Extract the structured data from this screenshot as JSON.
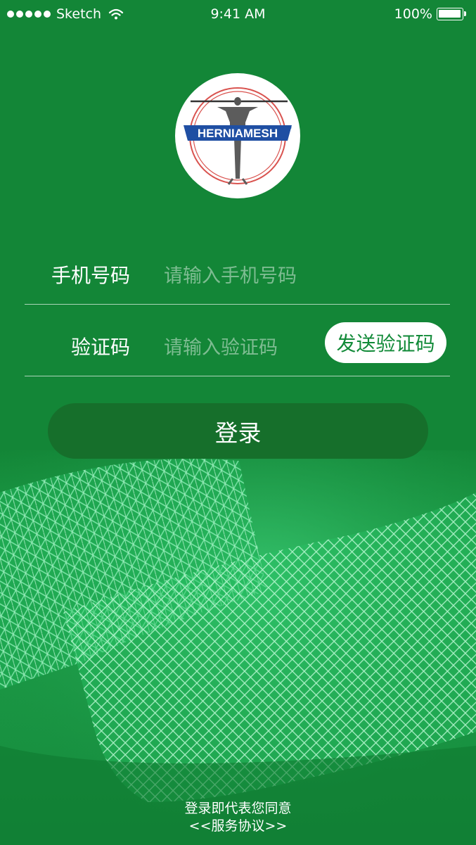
{
  "status_bar": {
    "carrier": "Sketch",
    "time": "9:41 AM",
    "battery": "100%",
    "battery_level": 1.0
  },
  "logo": {
    "brand_text": "HERNIAMESH",
    "registered_mark": "®"
  },
  "form": {
    "phone_label": "手机号码",
    "phone_placeholder": "请输入手机号码",
    "phone_value": "",
    "code_label": "验证码",
    "code_placeholder": "请输入验证码",
    "code_value": "",
    "send_code_label": "发送验证码",
    "login_label": "登录"
  },
  "footer": {
    "agreement_text": "登录即代表您同意",
    "agreement_link": "<<服务协议>>"
  },
  "colors": {
    "background": "#138637",
    "login_button": "#166f2b",
    "send_button_text": "#118a38",
    "logo_blue": "#1f4fa3",
    "logo_ring_red": "#d9534f"
  },
  "icons": {
    "signal": "signal-dots-icon",
    "wifi": "wifi-icon",
    "battery": "battery-icon"
  }
}
